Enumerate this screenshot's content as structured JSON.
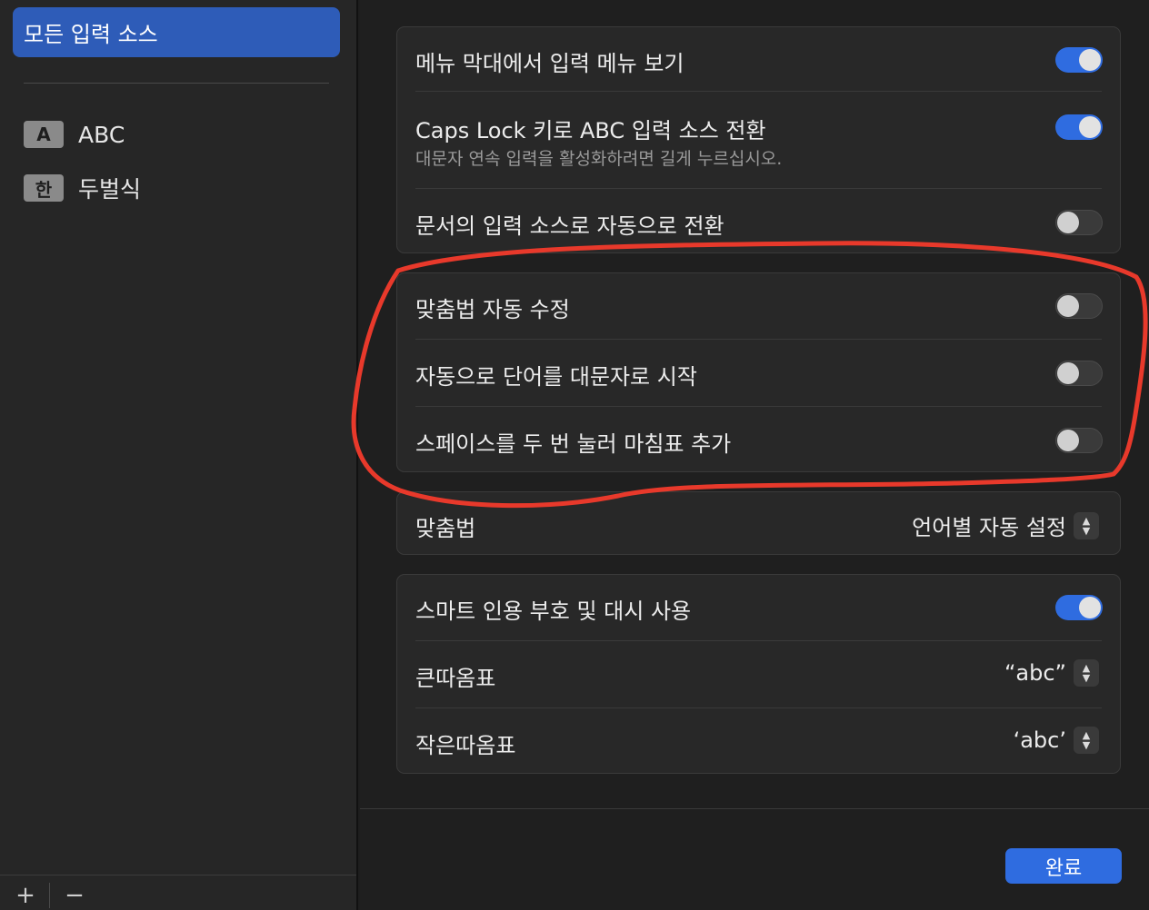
{
  "sidebar": {
    "selected_label": "모든 입력 소스",
    "items": [
      {
        "badge": "A",
        "label": "ABC"
      },
      {
        "badge": "한",
        "label": "두벌식"
      }
    ],
    "add_label": "+",
    "remove_label": "−"
  },
  "group1": {
    "row1": {
      "label": "메뉴 막대에서 입력 메뉴 보기",
      "on": true
    },
    "row2": {
      "label": "Caps Lock 키로 ABC 입력 소스 전환",
      "sub": "대문자 연속 입력을 활성화하려면 길게 누르십시오.",
      "on": true
    },
    "row3": {
      "label": "문서의 입력 소스로 자동으로 전환",
      "on": false
    }
  },
  "group2": {
    "row1": {
      "label": "맞춤법 자동 수정",
      "on": false
    },
    "row2": {
      "label": "자동으로 단어를 대문자로 시작",
      "on": false
    },
    "row3": {
      "label": "스페이스를 두 번 눌러 마침표 추가",
      "on": false
    }
  },
  "group3": {
    "label": "맞춤법",
    "value": "언어별 자동 설정"
  },
  "group4": {
    "row1": {
      "label": "스마트 인용 부호 및 대시 사용",
      "on": true
    },
    "row2": {
      "label": "큰따옴표",
      "value": "“abc”"
    },
    "row3": {
      "label": "작은따옴표",
      "value": "‘abc’"
    }
  },
  "footer": {
    "done_label": "완료"
  },
  "colors": {
    "accent": "#2f6ce0",
    "annotation": "#e8392b"
  }
}
